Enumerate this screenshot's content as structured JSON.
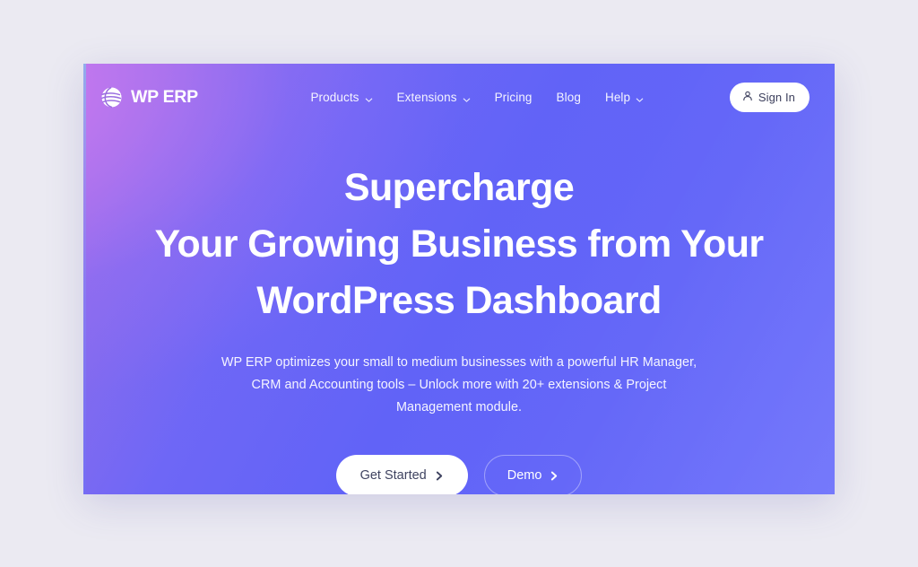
{
  "site": {
    "brand": "WP ERP",
    "logo_icon": "wperp-globe-swirl-icon"
  },
  "nav": {
    "items": [
      {
        "label": "Products",
        "has_dropdown": true,
        "icon": "chevron-down-icon"
      },
      {
        "label": "Extensions",
        "has_dropdown": true,
        "icon": "chevron-down-icon"
      },
      {
        "label": "Pricing",
        "has_dropdown": false,
        "icon": ""
      },
      {
        "label": "Blog",
        "has_dropdown": false,
        "icon": ""
      },
      {
        "label": "Help",
        "has_dropdown": true,
        "icon": "chevron-down-icon"
      }
    ],
    "signin": {
      "label": "Sign In",
      "icon": "user-person-icon"
    }
  },
  "hero": {
    "headline_lines": [
      "Supercharge",
      "Your Growing Business from Your",
      "WordPress Dashboard"
    ],
    "subtitle": "WP ERP optimizes your small to medium businesses with a powerful HR Manager, CRM and Accounting tools – Unlock more with 20+ extensions & Project Management module.",
    "cta_primary": {
      "label": "Get Started",
      "icon": "chevron-right-icon"
    },
    "cta_secondary": {
      "label": "Demo",
      "icon": "chevron-right-icon"
    }
  },
  "colors": {
    "page_background": "#ebeaf2",
    "hero_gradient_start": "#b06fe4",
    "hero_gradient_end": "#6163f7",
    "accent_blue_violet": "#6163f7",
    "button_text_dark": "#3f4360",
    "white": "#ffffff"
  }
}
